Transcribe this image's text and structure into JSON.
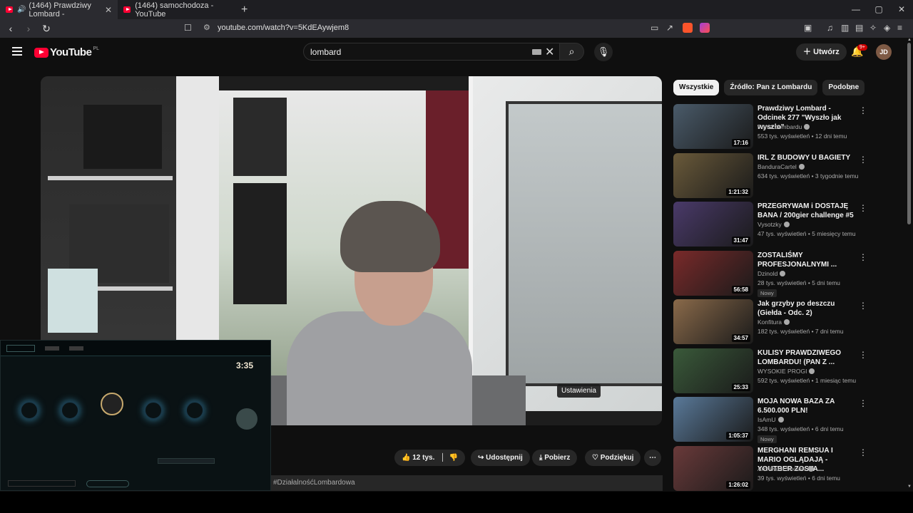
{
  "browser": {
    "tabs": [
      {
        "label": "(1464) Prawdziwy Lombard -",
        "active": true
      },
      {
        "label": "(1464) samochodoza - YouTube",
        "active": false
      }
    ],
    "url": "youtube.com/watch?v=5KdEAywjem8"
  },
  "youtube": {
    "logo_text": "YouTube",
    "country_code": "PL",
    "search_value": "lombard",
    "create_label": "Utwórz",
    "notif_badge": "9+",
    "avatar_initials": "JD"
  },
  "player": {
    "tooltip": "Ustawienia"
  },
  "game_overlay": {
    "timer": "3:35"
  },
  "actions": {
    "likes": "12 tys.",
    "share": "Udostępnij",
    "download": "Pobierz",
    "thanks": "Podziękuj"
  },
  "hashtags": "#DziałalnośćLombardowa",
  "chips": [
    "Wszystkie",
    "Źródło: Pan z Lombardu",
    "Podobne"
  ],
  "recommendations": [
    {
      "title": "Prawdziwy Lombard - Odcinek 277 \"Wyszło jak wyszło\"",
      "channel": "Pan z Lombardu",
      "meta": "553 tys. wyświetleń • 12 dni temu",
      "duration": "17:16",
      "new": "",
      "color": "#4a5b6a"
    },
    {
      "title": "IRL Z BUDOWY U BAGIETY",
      "channel": "BanduraCartel",
      "meta": "634 tys. wyświetleń • 3 tygodnie temu",
      "duration": "1:21:32",
      "new": "",
      "color": "#6a5a3a"
    },
    {
      "title": "PRZEGRYWAM i DOSTAJĘ BANA / 200gier challenge #5",
      "channel": "Vysotzky",
      "meta": "47 tys. wyświetleń • 5 miesięcy temu",
      "duration": "31:47",
      "new": "",
      "color": "#4a3a6a"
    },
    {
      "title": "ZOSTALIŚMY PROFESJONALNYMI ...",
      "channel": "Dzinold",
      "meta": "28 tys. wyświetleń • 5 dni temu",
      "duration": "56:58",
      "new": "Nowy",
      "color": "#7a2a2a"
    },
    {
      "title": "Jak grzyby po deszczu (Giełda - Odc. 2)",
      "channel": "Konfitura",
      "meta": "182 tys. wyświetleń • 7 dni temu",
      "duration": "34:57",
      "new": "",
      "color": "#8a6a4a"
    },
    {
      "title": "KULISY PRAWDZIWEGO LOMBARDU! (PAN Z ...",
      "channel": "WYSOKIE PROGI",
      "meta": "592 tys. wyświetleń • 1 miesiąc temu",
      "duration": "25:33",
      "new": "",
      "color": "#3a5a3a"
    },
    {
      "title": "MOJA NOWA BAZA ZA 6.500.000 PLN!",
      "channel": "IsAmU",
      "meta": "348 tys. wyświetleń • 6 dni temu",
      "duration": "1:05:37",
      "new": "Nowy",
      "color": "#5a7a9a"
    },
    {
      "title": "MERGHANI REMSUA I MARIO OGLĄDAJĄ - YOUTBER ZOSTA...",
      "channel": "Archiwum Shotów",
      "meta": "39 tys. wyświetleń • 6 dni temu",
      "duration": "1:26:02",
      "new": "",
      "color": "#6a3a3a"
    }
  ]
}
